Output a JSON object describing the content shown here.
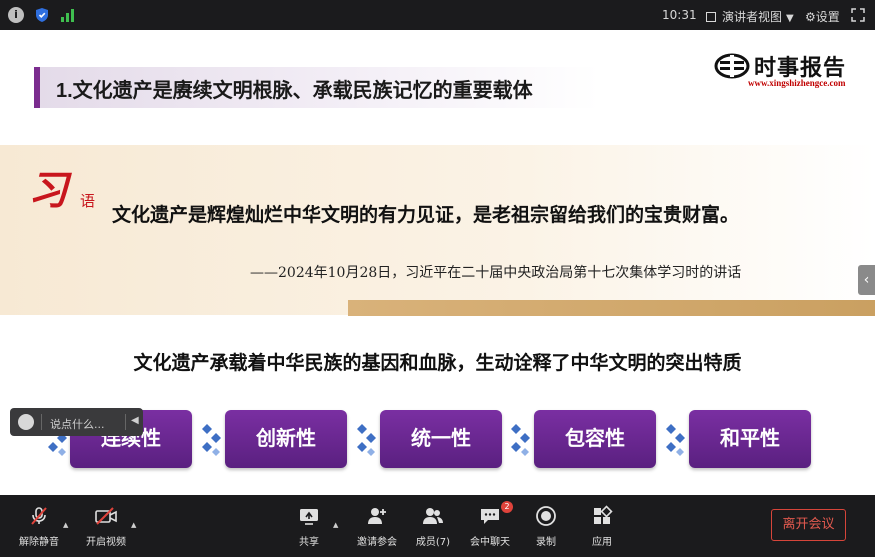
{
  "topbar": {
    "time": "10:31",
    "presenter_view": "演讲者视图",
    "settings": "设置",
    "icons": [
      "info-icon",
      "shield-icon",
      "signal-icon",
      "presenter-view-icon",
      "gear-icon",
      "fullscreen-icon"
    ]
  },
  "slide": {
    "title": "1.文化遗产是赓续文明根脉、承载民族记忆的重要载体",
    "logo_text": "时事报告",
    "logo_url": "www.xingshizhengce.com",
    "xi": "习",
    "yu": "语",
    "quote": "文化遗产是辉煌灿烂中华文明的有力见证，是老祖宗留给我们的宝贵财富。",
    "source": "——2024年10月28日，习近平在二十届中央政治局第十七次集体学习时的讲话",
    "subtitle": "文化遗产承载着中华民族的基因和血脉，生动诠释了中华文明的突出特质",
    "traits": [
      "连续性",
      "创新性",
      "统一性",
      "包容性",
      "和平性"
    ],
    "colors": {
      "accent_purple": "#6a2591",
      "red": "#c8161d",
      "gold": "#d9b27a"
    }
  },
  "chat": {
    "placeholder": "说点什么..."
  },
  "toolbar": {
    "unmute": "解除静音",
    "start_video": "开启视频",
    "share": "共享",
    "invite": "邀请参会",
    "members": "成员(7)",
    "chat": "会中聊天",
    "chat_badge": "2",
    "record": "录制",
    "apps": "应用",
    "leave": "离开会议"
  }
}
